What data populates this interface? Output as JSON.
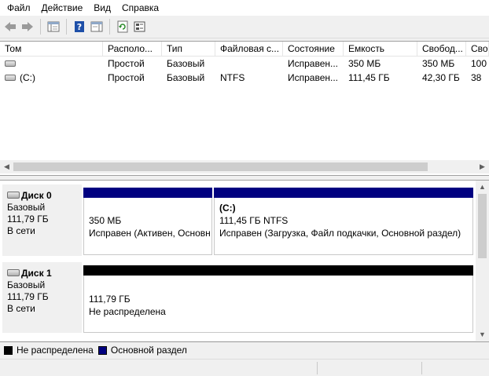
{
  "menu": [
    "Файл",
    "Действие",
    "Вид",
    "Справка"
  ],
  "toolbar": {
    "icons": [
      "back-arrow-icon",
      "forward-arrow-icon",
      "show-hide-tree-icon",
      "help-icon",
      "action-pane-icon",
      "refresh-icon",
      "properties-icon"
    ]
  },
  "volumes": {
    "columns": [
      "Том",
      "Располо...",
      "Тип",
      "Файловая с...",
      "Состояние",
      "Емкость",
      "Свобод...",
      "Сво"
    ],
    "rows": [
      [
        "",
        "Простой",
        "Базовый",
        "",
        "Исправен...",
        "350 МБ",
        "350 МБ",
        "100"
      ],
      [
        "(C:)",
        "Простой",
        "Базовый",
        "NTFS",
        "Исправен...",
        "111,45 ГБ",
        "42,30 ГБ",
        "38"
      ]
    ]
  },
  "disks": [
    {
      "name": "Диск 0",
      "type": "Базовый",
      "size": "111,79 ГБ",
      "status": "В сети",
      "partitions": [
        {
          "title": "",
          "size": "350 МБ",
          "state": "Исправен (Активен, Основной раздел)"
        },
        {
          "title": "(C:)",
          "size": "111,45 ГБ NTFS",
          "state": "Исправен (Загрузка, Файл подкачки, Основной раздел)"
        }
      ]
    },
    {
      "name": "Диск 1",
      "type": "Базовый",
      "size": "111,79 ГБ",
      "status": "В сети",
      "partitions": [
        {
          "size": "111,79 ГБ",
          "state": "Не распределена"
        }
      ]
    }
  ],
  "legend": [
    {
      "label": "Не распределена",
      "color": "#000000"
    },
    {
      "label": "Основной раздел",
      "color": "#000080"
    }
  ],
  "colors": {
    "primary_partition": "#000080",
    "unallocated": "#000000"
  }
}
